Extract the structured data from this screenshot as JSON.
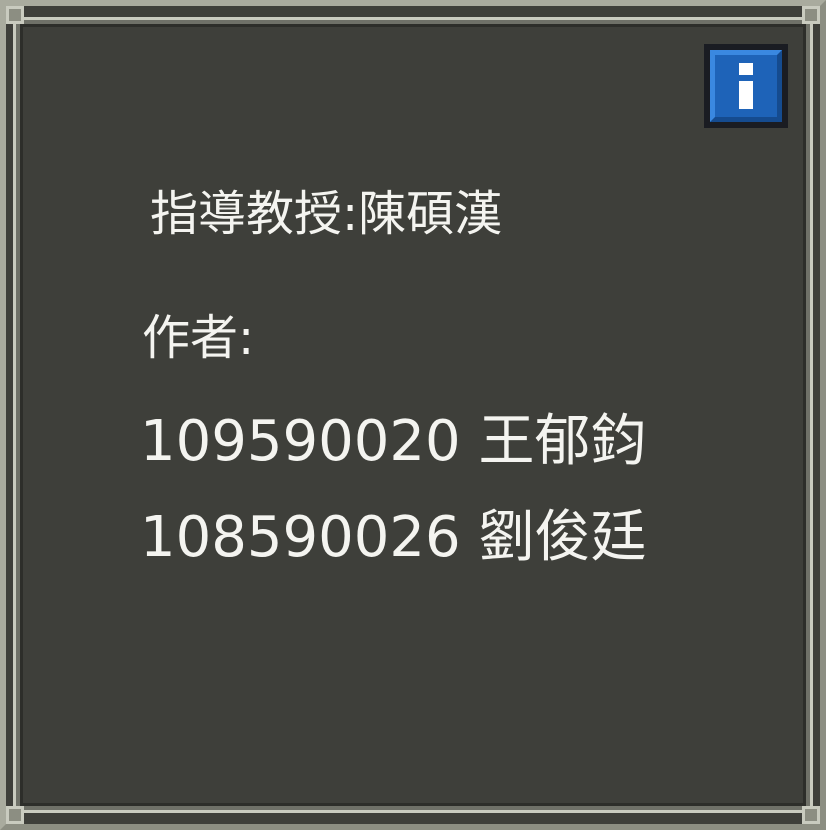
{
  "dialog": {
    "advisor": "指導教授:陳碩漢",
    "authors_label": "作者:",
    "authors": [
      "109590020 王郁鈞",
      "108590026 劉俊廷"
    ]
  },
  "info_button": {
    "icon": "info-icon",
    "colors": {
      "fill": "#1e63b8",
      "glyph": "#ffffff"
    }
  },
  "colors": {
    "panel_background": "#3e3f3a",
    "frame": "#a9ab9e",
    "text": "#f4f4f0"
  }
}
